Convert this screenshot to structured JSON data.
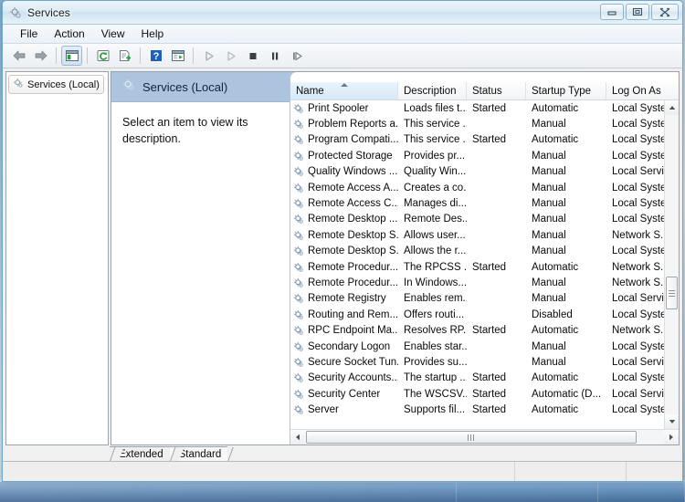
{
  "window": {
    "title": "Services",
    "icon": "services-gear-icon",
    "minimize_label": "Minimize",
    "maximize_label": "Restore Down",
    "close_label": "Close"
  },
  "menubar": {
    "items": [
      {
        "label": "File",
        "name": "menu-file"
      },
      {
        "label": "Action",
        "name": "menu-action"
      },
      {
        "label": "View",
        "name": "menu-view"
      },
      {
        "label": "Help",
        "name": "menu-help"
      }
    ]
  },
  "toolbar": {
    "buttons": [
      {
        "name": "back-icon",
        "glyph": "back"
      },
      {
        "name": "forward-icon",
        "glyph": "forward"
      },
      {
        "name": "show-tree-icon",
        "glyph": "tree",
        "pressed": true
      },
      {
        "name": "refresh-icon",
        "glyph": "refresh"
      },
      {
        "name": "export-list-icon",
        "glyph": "export"
      },
      {
        "name": "help-icon",
        "glyph": "help"
      },
      {
        "name": "properties-icon",
        "glyph": "properties"
      },
      {
        "name": "start-service-icon",
        "glyph": "play"
      },
      {
        "name": "resume-service-icon",
        "glyph": "play2"
      },
      {
        "name": "stop-service-icon",
        "glyph": "stop"
      },
      {
        "name": "pause-service-icon",
        "glyph": "pause"
      },
      {
        "name": "restart-service-icon",
        "glyph": "restart"
      }
    ]
  },
  "tree": {
    "root_label": "Services (Local)",
    "root_icon": "services-gear-icon"
  },
  "details": {
    "header_label": "Services (Local)",
    "header_icon": "services-gear-icon",
    "description": "Select an item to view its description."
  },
  "list": {
    "columns": [
      {
        "label": "Name",
        "name": "column-name",
        "sorted": true
      },
      {
        "label": "Description",
        "name": "column-description",
        "sorted": false
      },
      {
        "label": "Status",
        "name": "column-status",
        "sorted": false
      },
      {
        "label": "Startup Type",
        "name": "column-startup-type",
        "sorted": false
      },
      {
        "label": "Log On As",
        "name": "column-log-on-as",
        "sorted": false
      }
    ],
    "sort_direction": "ascending",
    "rows": [
      {
        "name": "Print Spooler",
        "description": "Loads files t...",
        "status": "Started",
        "startup": "Automatic",
        "logon": "Local Syste..."
      },
      {
        "name": "Problem Reports a...",
        "description": "This service ...",
        "status": "",
        "startup": "Manual",
        "logon": "Local Syste..."
      },
      {
        "name": "Program Compati...",
        "description": "This service ...",
        "status": "Started",
        "startup": "Automatic",
        "logon": "Local Syste..."
      },
      {
        "name": "Protected Storage",
        "description": "Provides pr...",
        "status": "",
        "startup": "Manual",
        "logon": "Local Syste..."
      },
      {
        "name": "Quality Windows ...",
        "description": "Quality Win...",
        "status": "",
        "startup": "Manual",
        "logon": "Local Service"
      },
      {
        "name": "Remote Access A...",
        "description": "Creates a co...",
        "status": "",
        "startup": "Manual",
        "logon": "Local Syste..."
      },
      {
        "name": "Remote Access C...",
        "description": "Manages di...",
        "status": "",
        "startup": "Manual",
        "logon": "Local Syste..."
      },
      {
        "name": "Remote Desktop ...",
        "description": "Remote Des...",
        "status": "",
        "startup": "Manual",
        "logon": "Local Syste..."
      },
      {
        "name": "Remote Desktop S...",
        "description": "Allows user...",
        "status": "",
        "startup": "Manual",
        "logon": "Network S..."
      },
      {
        "name": "Remote Desktop S...",
        "description": "Allows the r...",
        "status": "",
        "startup": "Manual",
        "logon": "Local Syste..."
      },
      {
        "name": "Remote Procedur...",
        "description": "The RPCSS ...",
        "status": "Started",
        "startup": "Automatic",
        "logon": "Network S..."
      },
      {
        "name": "Remote Procedur...",
        "description": "In Windows...",
        "status": "",
        "startup": "Manual",
        "logon": "Network S..."
      },
      {
        "name": "Remote Registry",
        "description": "Enables rem...",
        "status": "",
        "startup": "Manual",
        "logon": "Local Service"
      },
      {
        "name": "Routing and Rem...",
        "description": "Offers routi...",
        "status": "",
        "startup": "Disabled",
        "logon": "Local Syste..."
      },
      {
        "name": "RPC Endpoint Ma...",
        "description": "Resolves RP...",
        "status": "Started",
        "startup": "Automatic",
        "logon": "Network S..."
      },
      {
        "name": "Secondary Logon",
        "description": "Enables star...",
        "status": "",
        "startup": "Manual",
        "logon": "Local Syste..."
      },
      {
        "name": "Secure Socket Tun...",
        "description": "Provides su...",
        "status": "",
        "startup": "Manual",
        "logon": "Local Service"
      },
      {
        "name": "Security Accounts...",
        "description": "The startup ...",
        "status": "Started",
        "startup": "Automatic",
        "logon": "Local Syste..."
      },
      {
        "name": "Security Center",
        "description": "The WSCSV...",
        "status": "Started",
        "startup": "Automatic (D...",
        "logon": "Local Service"
      },
      {
        "name": "Server",
        "description": "Supports fil...",
        "status": "Started",
        "startup": "Automatic",
        "logon": "Local Syste..."
      }
    ]
  },
  "tabs": [
    {
      "label": "Extended",
      "name": "tab-extended",
      "active": false
    },
    {
      "label": "Standard",
      "name": "tab-standard",
      "active": true
    }
  ],
  "colors": {
    "header_band": "#acc4de",
    "sorted_column": "#d7e9f7",
    "window_border": "#6ea9c9"
  }
}
